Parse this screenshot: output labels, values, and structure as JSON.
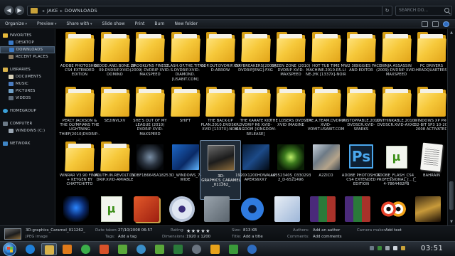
{
  "window": {
    "breadcrumb": [
      "Jake",
      "Downloads"
    ],
    "search_placeholder": "Search Do..."
  },
  "toolbar": {
    "items": [
      "Organize",
      "Preview",
      "Share with",
      "Slide show",
      "Print",
      "Burn",
      "New folder"
    ]
  },
  "navigation": {
    "favorites": {
      "header": "Favorites",
      "items": [
        "Desktop",
        "Downloads",
        "Recent Places"
      ]
    },
    "libraries": {
      "header": "Libraries",
      "items": [
        "Documents",
        "Music",
        "Pictures",
        "Videos"
      ]
    },
    "homegroup": "Homegroup",
    "computer": {
      "header": "Computer",
      "items": [
        "Windows (C:)"
      ]
    },
    "network": "Network"
  },
  "files": {
    "row1": [
      "Adobe Photoshop CS4 Extended Edition",
      "Blood.And.Bone.2009.DVDRip.XviD-DOMINO",
      "Brooklyns Finest (2009) DVDRip XviD-MAXSPEED",
      "Clash.Of.The.Titans.DVDRip.XviD-DiAMOND.[Usabit.com]",
      "Cop.Out.DVDRip.XviD-ARROW",
      "Daybreakers[2009]DVDRip[Eng]-FXG",
      "Green Zone (2010) DVDRip XviD-MAXSPEED",
      "Hot Tub Time Machine.2010.R5.LiNE-JYK [1337x]-Noir",
      "Mw2 3ibiggies Face and Editor",
      "Ninja Assassin (2009) DVDRip XviD-MAXSPEED",
      "PC Drivers HeadQuarters"
    ],
    "row2": [
      "Percy Jackson & The Olympians The Lightning Thief(2010)DVDRip-...",
      "SE2Invlxv",
      "She's Out Of My League (2010) DVDRip XviD-MAXSPEED",
      "shift",
      "The Back-up Plan.2010.DvdSkr.XviD [1337x]-Noir",
      "The Karate Kid DVDRip R6 XviD-KINGDOM [Kingdom-Release]",
      "The Losers DVDSCR XViD IMAGiNE",
      "The.A.Team.DVDRip.XviD-VoMiT.Usabit.com",
      "Unstoppable.2010.DvdScr.XviD-SPARKS",
      "Unthinkable.2010.DVDSCR.XviD-AXXO",
      "Windows XP Pro 32-Bit SP3 10-20-2008 Activated"
    ],
    "row3": [
      "WinRAR v3.90 Final + Keygen By ChattChitto",
      "Youth.In.Revolt.DVDRip.XviD-AMIABLE",
      "0dbf1b6645a1825",
      "3d_windows_7-wide",
      "3D-graphics_Caramel_011262_",
      "1920x1200hdwallpapers6xx7",
      "46352340S_03302932_d-6521496",
      "a2zico",
      "Adobe Photoshop CS4 Extended Edition",
      "Adobe_Flash_CS4_Professional_[...]_4-7864482PB",
      "Bahrain"
    ]
  },
  "selected_file": "3D-graphics_Caramel_011262_",
  "details": {
    "name": "3D-graphics_Caramel_011262_",
    "type": "JPEG image",
    "date_taken_label": "Date taken:",
    "date_taken": "27/10/2008 06:57",
    "tags_label": "Tags:",
    "tags": "Add a tag",
    "rating_label": "Rating:",
    "rating_stars": 5,
    "dimensions_label": "Dimensions:",
    "dimensions": "1920 x 1200",
    "size_label": "Size:",
    "size": "813 KB",
    "title_label": "Title:",
    "title": "Add a title",
    "authors_label": "Authors:",
    "authors": "Add an author",
    "comments_label": "Comments:",
    "comments": "Add comments",
    "camera_label": "Camera maker:",
    "camera": "Add text"
  },
  "taskbar": {
    "clock": "03:51",
    "pinned_icons": [
      "ie-icon",
      "folder-icon",
      "media-player-icon",
      "chrome-icon",
      "ubuntu-icon",
      "xbox-icon",
      "pictures-icon",
      "xbox-icon",
      "media-center-icon",
      "vlc-icon",
      "runner-icon",
      "limewire-icon",
      "windows-icon"
    ]
  },
  "colors": {
    "folder": "#f6c83a",
    "accent": "#4ba8ee"
  }
}
